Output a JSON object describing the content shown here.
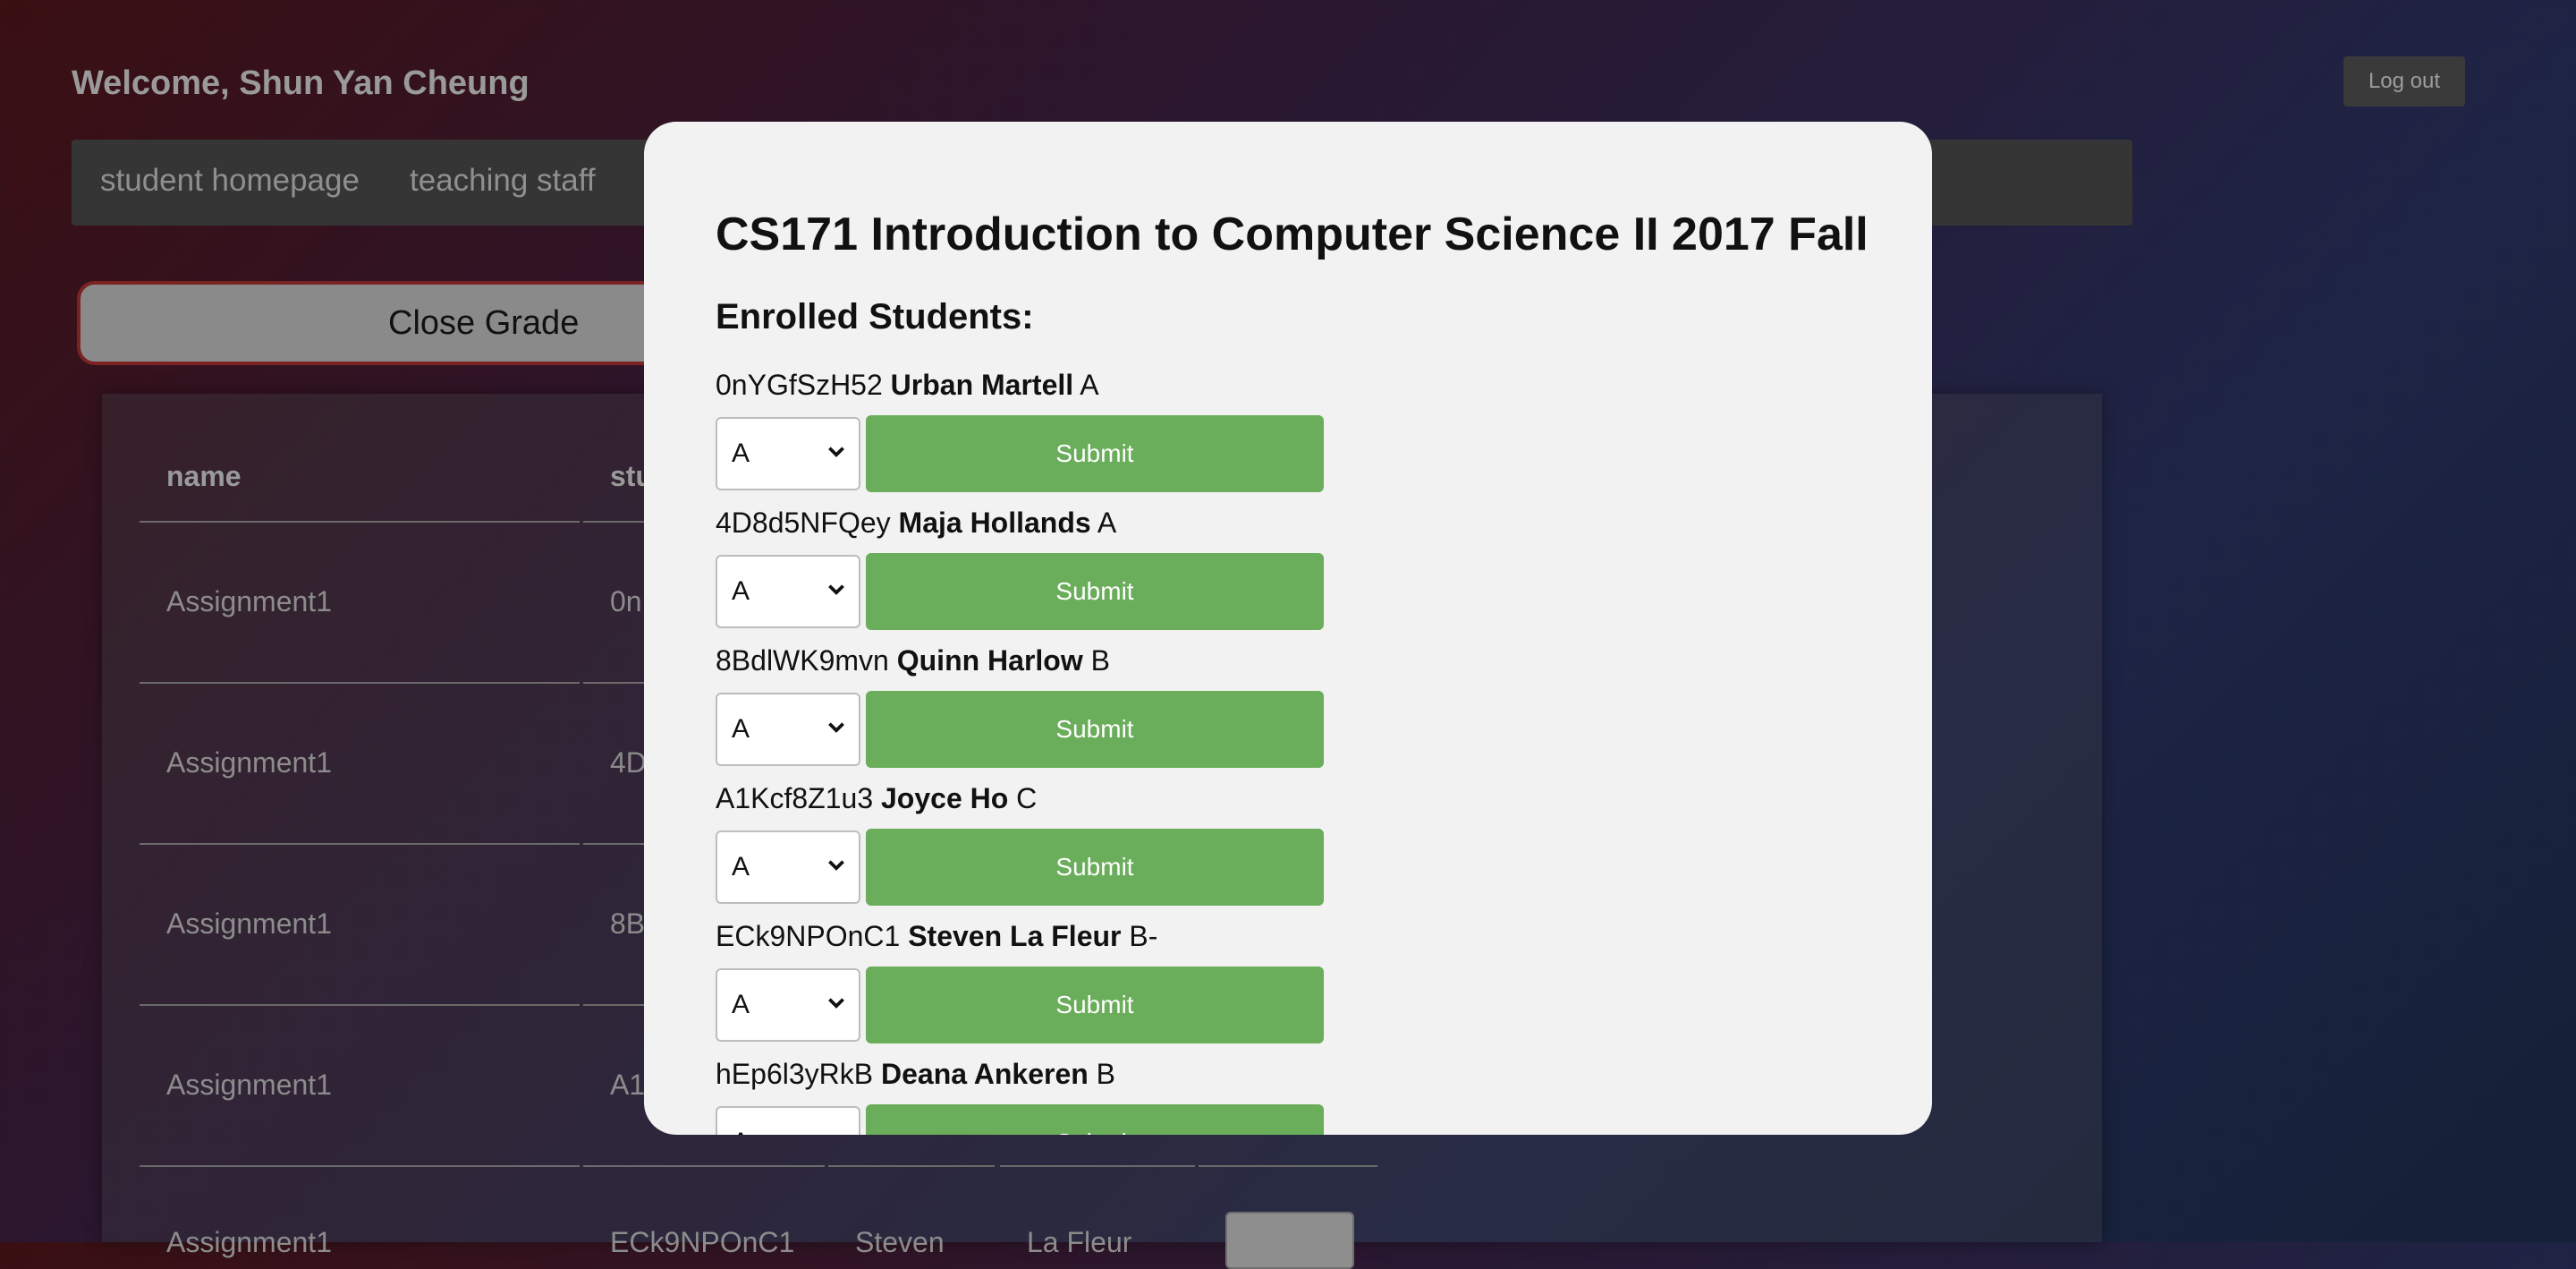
{
  "header": {
    "welcome": "Welcome, Shun Yan Cheung",
    "logout_label": "Log out"
  },
  "nav": {
    "items": [
      "student homepage",
      "teaching staff"
    ]
  },
  "close_grade_label": "Close Grade",
  "table": {
    "headers": [
      "name",
      "stu"
    ],
    "rows": [
      {
        "name": "Assignment1",
        "stu": "0n"
      },
      {
        "name": "Assignment1",
        "stu": "4D"
      },
      {
        "name": "Assignment1",
        "stu": "8B"
      },
      {
        "name": "Assignment1",
        "stu": "A1"
      },
      {
        "name": "Assignment1",
        "stu": "ECk9NPOnC1",
        "first": "Steven",
        "last": "La Fleur"
      }
    ]
  },
  "modal": {
    "title": "CS171 Introduction to Computer Science II 2017 Fall",
    "subtitle": "Enrolled Students:",
    "submit_label": "Submit",
    "students": [
      {
        "id": "0nYGfSzH52",
        "name": "Urban Martell",
        "grade": "A",
        "selected": "A"
      },
      {
        "id": "4D8d5NFQey",
        "name": "Maja Hollands",
        "grade": "A",
        "selected": "A"
      },
      {
        "id": "8BdlWK9mvn",
        "name": "Quinn Harlow",
        "grade": "B",
        "selected": "A"
      },
      {
        "id": "A1Kcf8Z1u3",
        "name": "Joyce Ho",
        "grade": "C",
        "selected": "A"
      },
      {
        "id": "ECk9NPOnC1",
        "name": "Steven La Fleur",
        "grade": "B-",
        "selected": "A"
      },
      {
        "id": "hEp6l3yRkB",
        "name": "Deana Ankeren",
        "grade": "B",
        "selected": "A"
      }
    ]
  }
}
